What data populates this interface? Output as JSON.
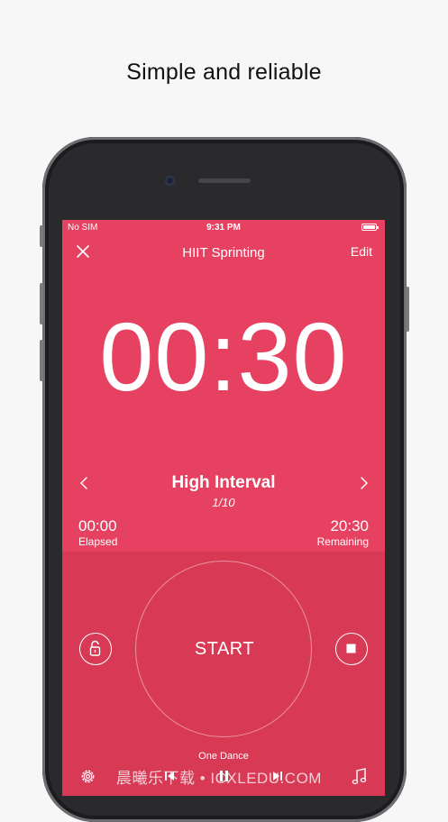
{
  "headline": "Simple and reliable",
  "status_bar": {
    "carrier": "No SIM",
    "time": "9:31 PM"
  },
  "nav": {
    "title": "HIIT Sprinting",
    "edit_label": "Edit"
  },
  "timer": {
    "display": "00:30"
  },
  "interval": {
    "name": "High Interval",
    "count": "1/10"
  },
  "elapsed": {
    "value": "00:00",
    "label": "Elapsed"
  },
  "remaining": {
    "value": "20:30",
    "label": "Remaining"
  },
  "controls": {
    "start_label": "START"
  },
  "music": {
    "song": "One Dance"
  },
  "watermark": "晨曦乐下载 • ICXLEDU.COM",
  "colors": {
    "accent": "#e64160",
    "accent_dark": "#d83a56",
    "text": "#ffffff"
  },
  "icons": {
    "close": "close-icon",
    "prev": "chevron-left-icon",
    "next": "chevron-right-icon",
    "lock": "lock-icon",
    "stop": "stop-icon",
    "settings": "gear-icon",
    "music": "music-note-icon",
    "media_prev": "previous-track-icon",
    "media_pause": "pause-icon",
    "media_next": "next-track-icon"
  }
}
